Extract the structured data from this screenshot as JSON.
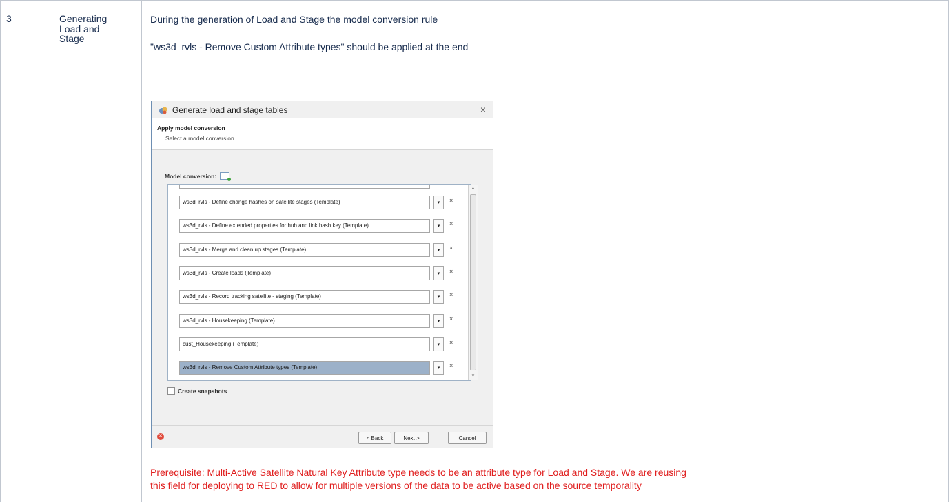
{
  "row": {
    "number": "3",
    "step_line1": "Generating",
    "step_line2": "Load and",
    "step_line3": "Stage",
    "desc1": "During the generation of Load and Stage the model conversion rule",
    "desc2": "\"ws3d_rvls - Remove Custom Attribute types\" should be applied at the end",
    "prereq1": "Prerequisite: Multi-Active Satellite Natural Key Attribute type needs to be an attribute type for Load and Stage. We are reusing",
    "prereq2": "this field for deploying to RED to allow for multiple versions of the data to be active based on the source temporality"
  },
  "dialog": {
    "title": "Generate load and stage tables",
    "close": "×",
    "header_title": "Apply model conversion",
    "header_sub": "Select a model conversion",
    "list_label": "Model conversion:",
    "items": [
      "ws3d_rvls - Define change hashes on satellite stages (Template)",
      "ws3d_rvls - Define extended properties for hub and link hash key (Template)",
      "ws3d_rvls - Merge and clean up stages (Template)",
      "ws3d_rvls - Create loads (Template)",
      "ws3d_rvls - Record tracking satellite - staging (Template)",
      "ws3d_rvls - Housekeeping (Template)",
      "cust_Housekeeping (Template)",
      "ws3d_rvls - Remove Custom Attribute types (Template)"
    ],
    "selected_index": 7,
    "dropdown_glyph": "▾",
    "remove_glyph": "×",
    "snapshots_label": "Create snapshots",
    "back_label": "< Back",
    "next_label": "Next >",
    "cancel_label": "Cancel"
  }
}
